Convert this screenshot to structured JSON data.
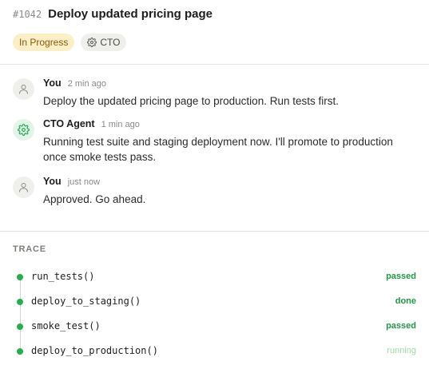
{
  "issue": {
    "id": "#1042",
    "title": "Deploy updated pricing page",
    "status": "In Progress",
    "agent_badge": "CTO"
  },
  "messages": [
    {
      "author": "You",
      "time": "2 min ago",
      "text": "Deploy the updated pricing page to production. Run tests first.",
      "avatar_icon": "user-icon"
    },
    {
      "author": "CTO Agent",
      "time": "1 min ago",
      "text": "Running test suite and staging deployment now. I'll promote to production once smoke tests pass.",
      "avatar_icon": "gear-icon"
    },
    {
      "author": "You",
      "time": "just now",
      "text": "Approved. Go ahead.",
      "avatar_icon": "user-icon"
    }
  ],
  "trace": {
    "label": "TRACE",
    "steps": [
      {
        "name": "run_tests()",
        "status": "passed"
      },
      {
        "name": "deploy_to_staging()",
        "status": "done"
      },
      {
        "name": "smoke_test()",
        "status": "passed"
      },
      {
        "name": "deploy_to_production()",
        "status": "running"
      }
    ]
  },
  "colors": {
    "success": "#22b04b",
    "status_badge_bg": "#fbefc6",
    "status_badge_text": "#8a5a0a",
    "running": "#9fdcad"
  }
}
